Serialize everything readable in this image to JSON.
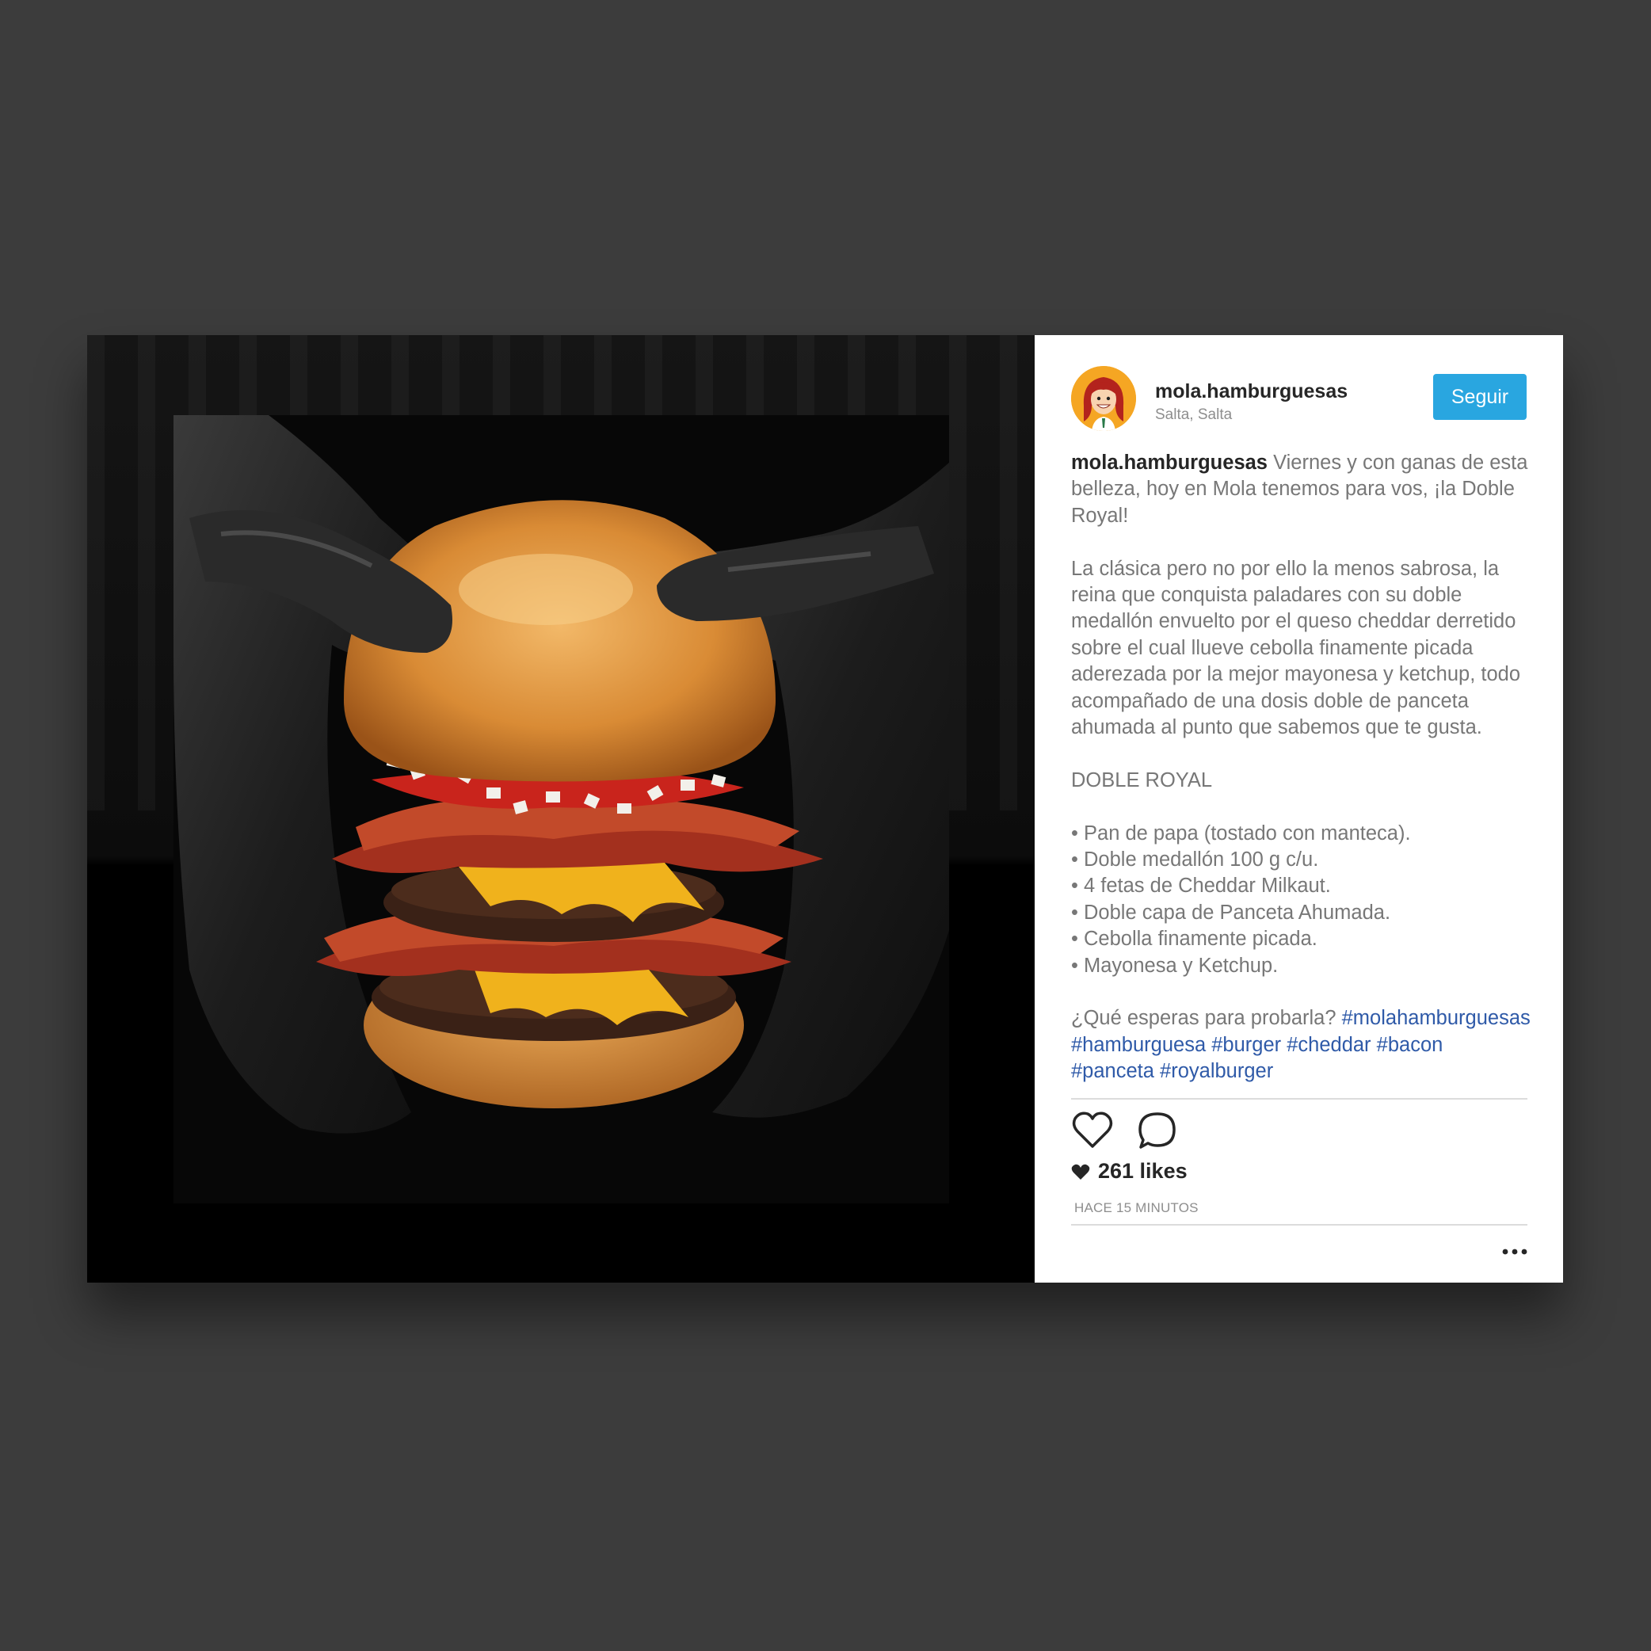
{
  "post": {
    "username": "mola.hamburguesas",
    "location": "Salta, Salta",
    "follow_label": "Seguir",
    "caption_user": "mola.hamburguesas",
    "caption_intro": "Viernes y con ganas de esta belleza, hoy en Mola tenemos para vos, ¡la Doble Royal!",
    "caption_body": "La clásica pero no por ello la menos sabrosa, la reina que conquista paladares con su doble medallón envuelto por el queso cheddar derretido sobre el cual llueve cebolla finamente picada aderezada por la mejor mayonesa y ketchup, todo acompañado de una dosis doble de panceta ahumada al punto que sabemos que te gusta.",
    "product_name": "DOBLE ROYAL",
    "ingredients": [
      "• Pan de papa (tostado con manteca).",
      "• Doble medallón 100 g c/u.",
      "• 4 fetas de Cheddar Milkaut.",
      "• Doble capa de Panceta Ahumada.",
      "• Cebolla finamente picada.",
      "• Mayonesa y Ketchup."
    ],
    "question": "¿Qué esperas para probarla?",
    "hashtags": [
      "#molahamburguesas",
      "#hamburguesa",
      "#burger",
      "#cheddar",
      "#bacon",
      "#panceta",
      "#royalburger"
    ],
    "likes": "261 likes",
    "time": "HACE 15 MINUTOS"
  },
  "icons": {
    "like": "heart-outline-icon",
    "comment": "speech-bubble-icon",
    "likes_heart": "heart-filled-icon",
    "more": "ellipsis-icon"
  },
  "colors": {
    "background": "#3c3c3c",
    "follow_button": "#29a6e0",
    "hashtag": "#2f5aa8",
    "caption_text": "#777777"
  }
}
